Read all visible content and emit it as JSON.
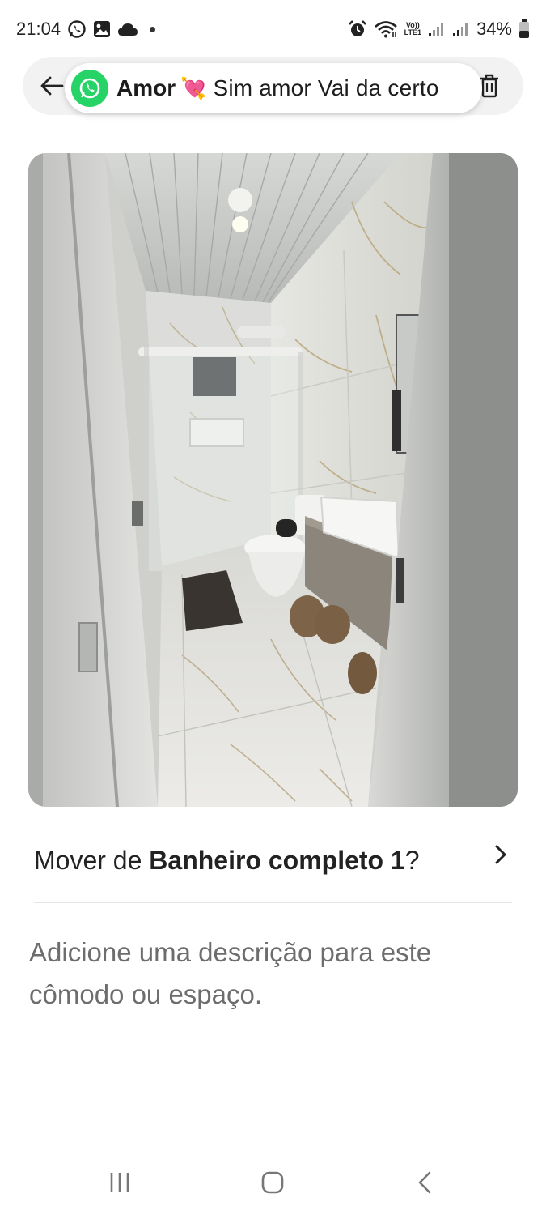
{
  "status_bar": {
    "time": "21:04",
    "battery": "34%",
    "icons": [
      "whatsapp-icon",
      "gallery-icon",
      "cloud-icon",
      "dot-icon",
      "alarm-icon",
      "wifi-icon",
      "volte-icon",
      "signal-icon",
      "signal-icon",
      "battery-icon"
    ],
    "volte_top": "Vo))",
    "volte_bottom": "LTE1"
  },
  "notification": {
    "app_icon": "whatsapp-icon",
    "sender": "Amor",
    "emoji": "💘",
    "message": "Sim amor  Vai da certo"
  },
  "toolbar": {
    "back_icon": "arrow-left-icon",
    "delete_icon": "trash-icon"
  },
  "photo": {
    "description_icon": "bathroom-photo"
  },
  "room": {
    "prefix": "Mover de ",
    "name": "Banheiro completo 1",
    "suffix": "?",
    "chevron_icon": "chevron-right-icon"
  },
  "description": {
    "placeholder": "Adicione uma descrição para este cômodo ou espaço."
  },
  "nav": {
    "recents_icon": "recents-icon",
    "home_icon": "home-icon",
    "back_icon": "back-icon"
  },
  "colors": {
    "whatsapp_green": "#25d366",
    "placeholder_gray": "#6d6d6d",
    "pill_bg": "#f2f2f2"
  }
}
